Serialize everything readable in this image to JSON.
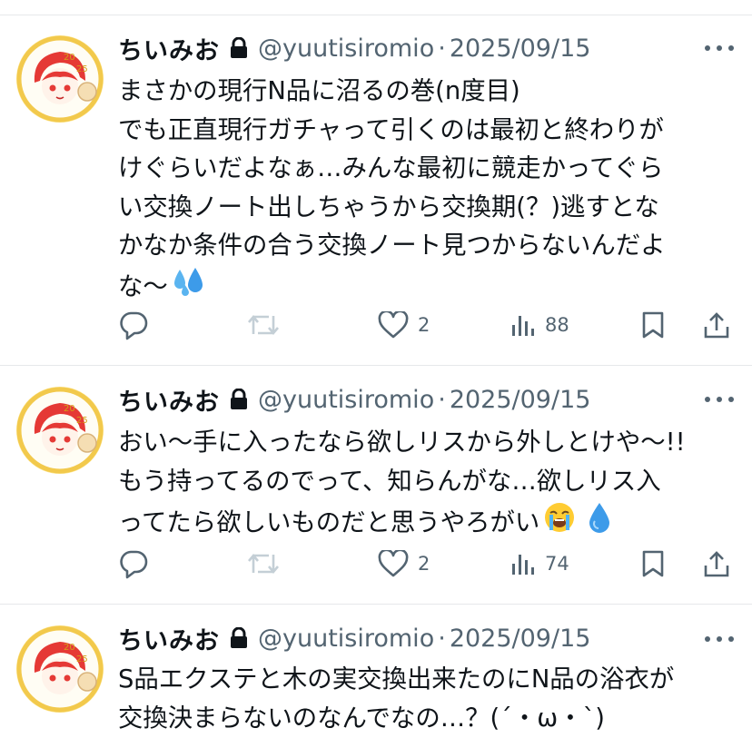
{
  "tweets": [
    {
      "author": "ちいみお",
      "handle": "@yuutisiromio",
      "separator": "·",
      "date": "2025/09/15",
      "lines": [
        "まさかの現行N品に沼るの巻(n度目)",
        "でも正直現行ガチャって引くのは最初と終わりが",
        "けぐらいだよなぁ…みんな最初に競走かってぐら",
        "い交換ノート出しちゃうから交換期(？)逃すとな",
        "かなか条件の合う交換ノート見つからないんだよ",
        "な〜"
      ],
      "emojis": [
        "sweat-droplets-emoji"
      ],
      "reply_count": "",
      "retweet_count": "",
      "like_count": "2",
      "view_count": "88"
    },
    {
      "author": "ちいみお",
      "handle": "@yuutisiromio",
      "separator": "·",
      "date": "2025/09/15",
      "lines": [
        "おい〜手に入ったなら欲しリスから外しとけや〜!!",
        "もう持ってるのでって、知らんがな…欲しリス入",
        "ってたら欲しいものだと思うやろがい"
      ],
      "emojis": [
        "loudly-crying-face-emoji",
        "droplet-emoji"
      ],
      "reply_count": "",
      "retweet_count": "",
      "like_count": "2",
      "view_count": "74"
    },
    {
      "author": "ちいみお",
      "handle": "@yuutisiromio",
      "separator": "·",
      "date": "2025/09/15",
      "lines": [
        "S品エクステと木の実交換出来たのにN品の浴衣が",
        "交換決まらないのなんでなの…？(´・ω・`)"
      ],
      "emojis": [],
      "reply_count": "",
      "retweet_count": "",
      "like_count": "",
      "view_count": ""
    }
  ],
  "colors": {
    "text": "#0f1419",
    "secondary": "#536471",
    "divider": "#e6e8ea",
    "retweet_disabled": "#c4cfd6"
  },
  "icons": {
    "reply": "reply-icon",
    "retweet": "retweet-icon",
    "like": "heart-icon",
    "views": "views-icon",
    "bookmark": "bookmark-icon",
    "share": "share-icon",
    "more": "more-icon",
    "lock": "lock-icon"
  }
}
